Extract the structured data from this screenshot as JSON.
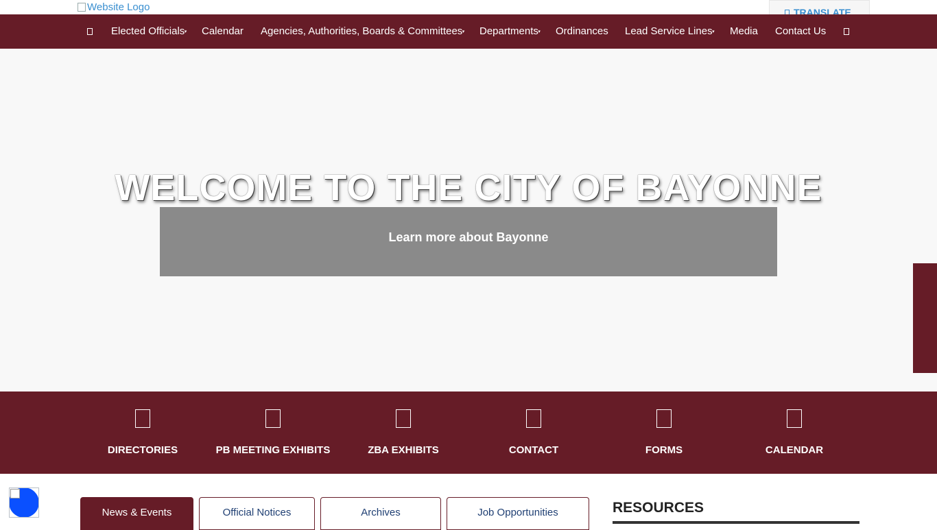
{
  "header": {
    "logo_alt": "Website Logo",
    "translate_label": "TRANSLATE"
  },
  "nav": {
    "items": [
      {
        "label": "Elected Officials"
      },
      {
        "label": "Calendar"
      },
      {
        "label": "Agencies, Authorities, Boards & Committees"
      },
      {
        "label": "Departments"
      },
      {
        "label": "Ordinances"
      },
      {
        "label": "Lead Service Lines"
      },
      {
        "label": "Media"
      },
      {
        "label": "Contact Us"
      }
    ]
  },
  "hero": {
    "title": "WELCOME TO THE CITY OF BAYONNE",
    "button_label": "Learn more about Bayonne"
  },
  "quick_links": [
    {
      "label": "DIRECTORIES"
    },
    {
      "label": "PB MEETING EXHIBITS"
    },
    {
      "label": "ZBA EXHIBITS"
    },
    {
      "label": "CONTACT"
    },
    {
      "label": "FORMS"
    },
    {
      "label": "CALENDAR"
    }
  ],
  "tabs": [
    {
      "label": "News & Events",
      "active": true
    },
    {
      "label": "Official Notices",
      "active": false
    },
    {
      "label": "Archives",
      "active": false
    },
    {
      "label": "Job Opportunities",
      "active": false
    }
  ],
  "sidebar": {
    "heading": "RESOURCES"
  },
  "colors": {
    "brand": "#661c27",
    "link": "#3a8fd0",
    "accessibility": "#0a50ff"
  }
}
